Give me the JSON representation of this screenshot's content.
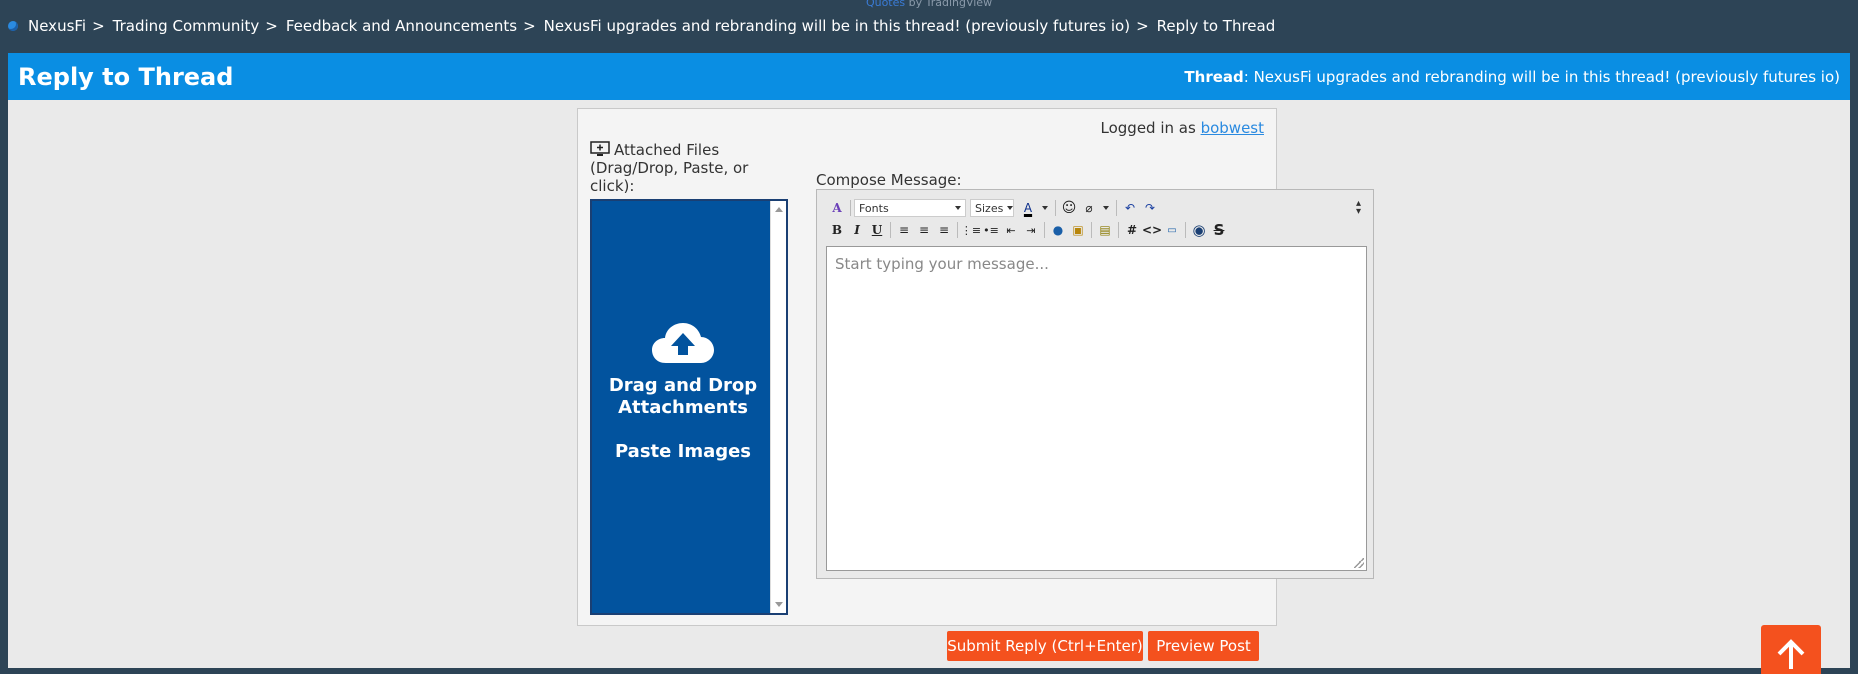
{
  "top_banner": {
    "quotes_link": "Quotes",
    "by_text": "by TradingView"
  },
  "breadcrumb": [
    {
      "label": "NexusFi"
    },
    {
      "label": "Trading Community"
    },
    {
      "label": "Feedback and Announcements"
    },
    {
      "label": "NexusFi upgrades and rebranding will be in this thread! (previously futures io)"
    },
    {
      "label": "Reply to Thread"
    }
  ],
  "breadcrumb_sep": ">",
  "header": {
    "title": "Reply to Thread",
    "thread_label": "Thread",
    "thread_title": ": NexusFi upgrades and rebranding will be in this thread! (previously futures io)"
  },
  "login": {
    "prefix": "Logged in as ",
    "username": "bobwest"
  },
  "attachments": {
    "label": "Attached Files (Drag/Drop, Paste, or click):",
    "drop_text": "Drag and Drop Attachments",
    "paste_text": "Paste Images"
  },
  "compose": {
    "label": "Compose Message:",
    "placeholder": "Start typing your message...",
    "fonts_select": "Fonts",
    "sizes_select": "Sizes"
  },
  "buttons": {
    "submit": "Submit Reply (Ctrl+Enter)",
    "preview": "Preview Post"
  },
  "colors": {
    "header_bg": "#0a8ee3",
    "accent_orange": "#f4511e",
    "dropzone_bg": "#02539e",
    "page_bg": "#2d4456"
  }
}
